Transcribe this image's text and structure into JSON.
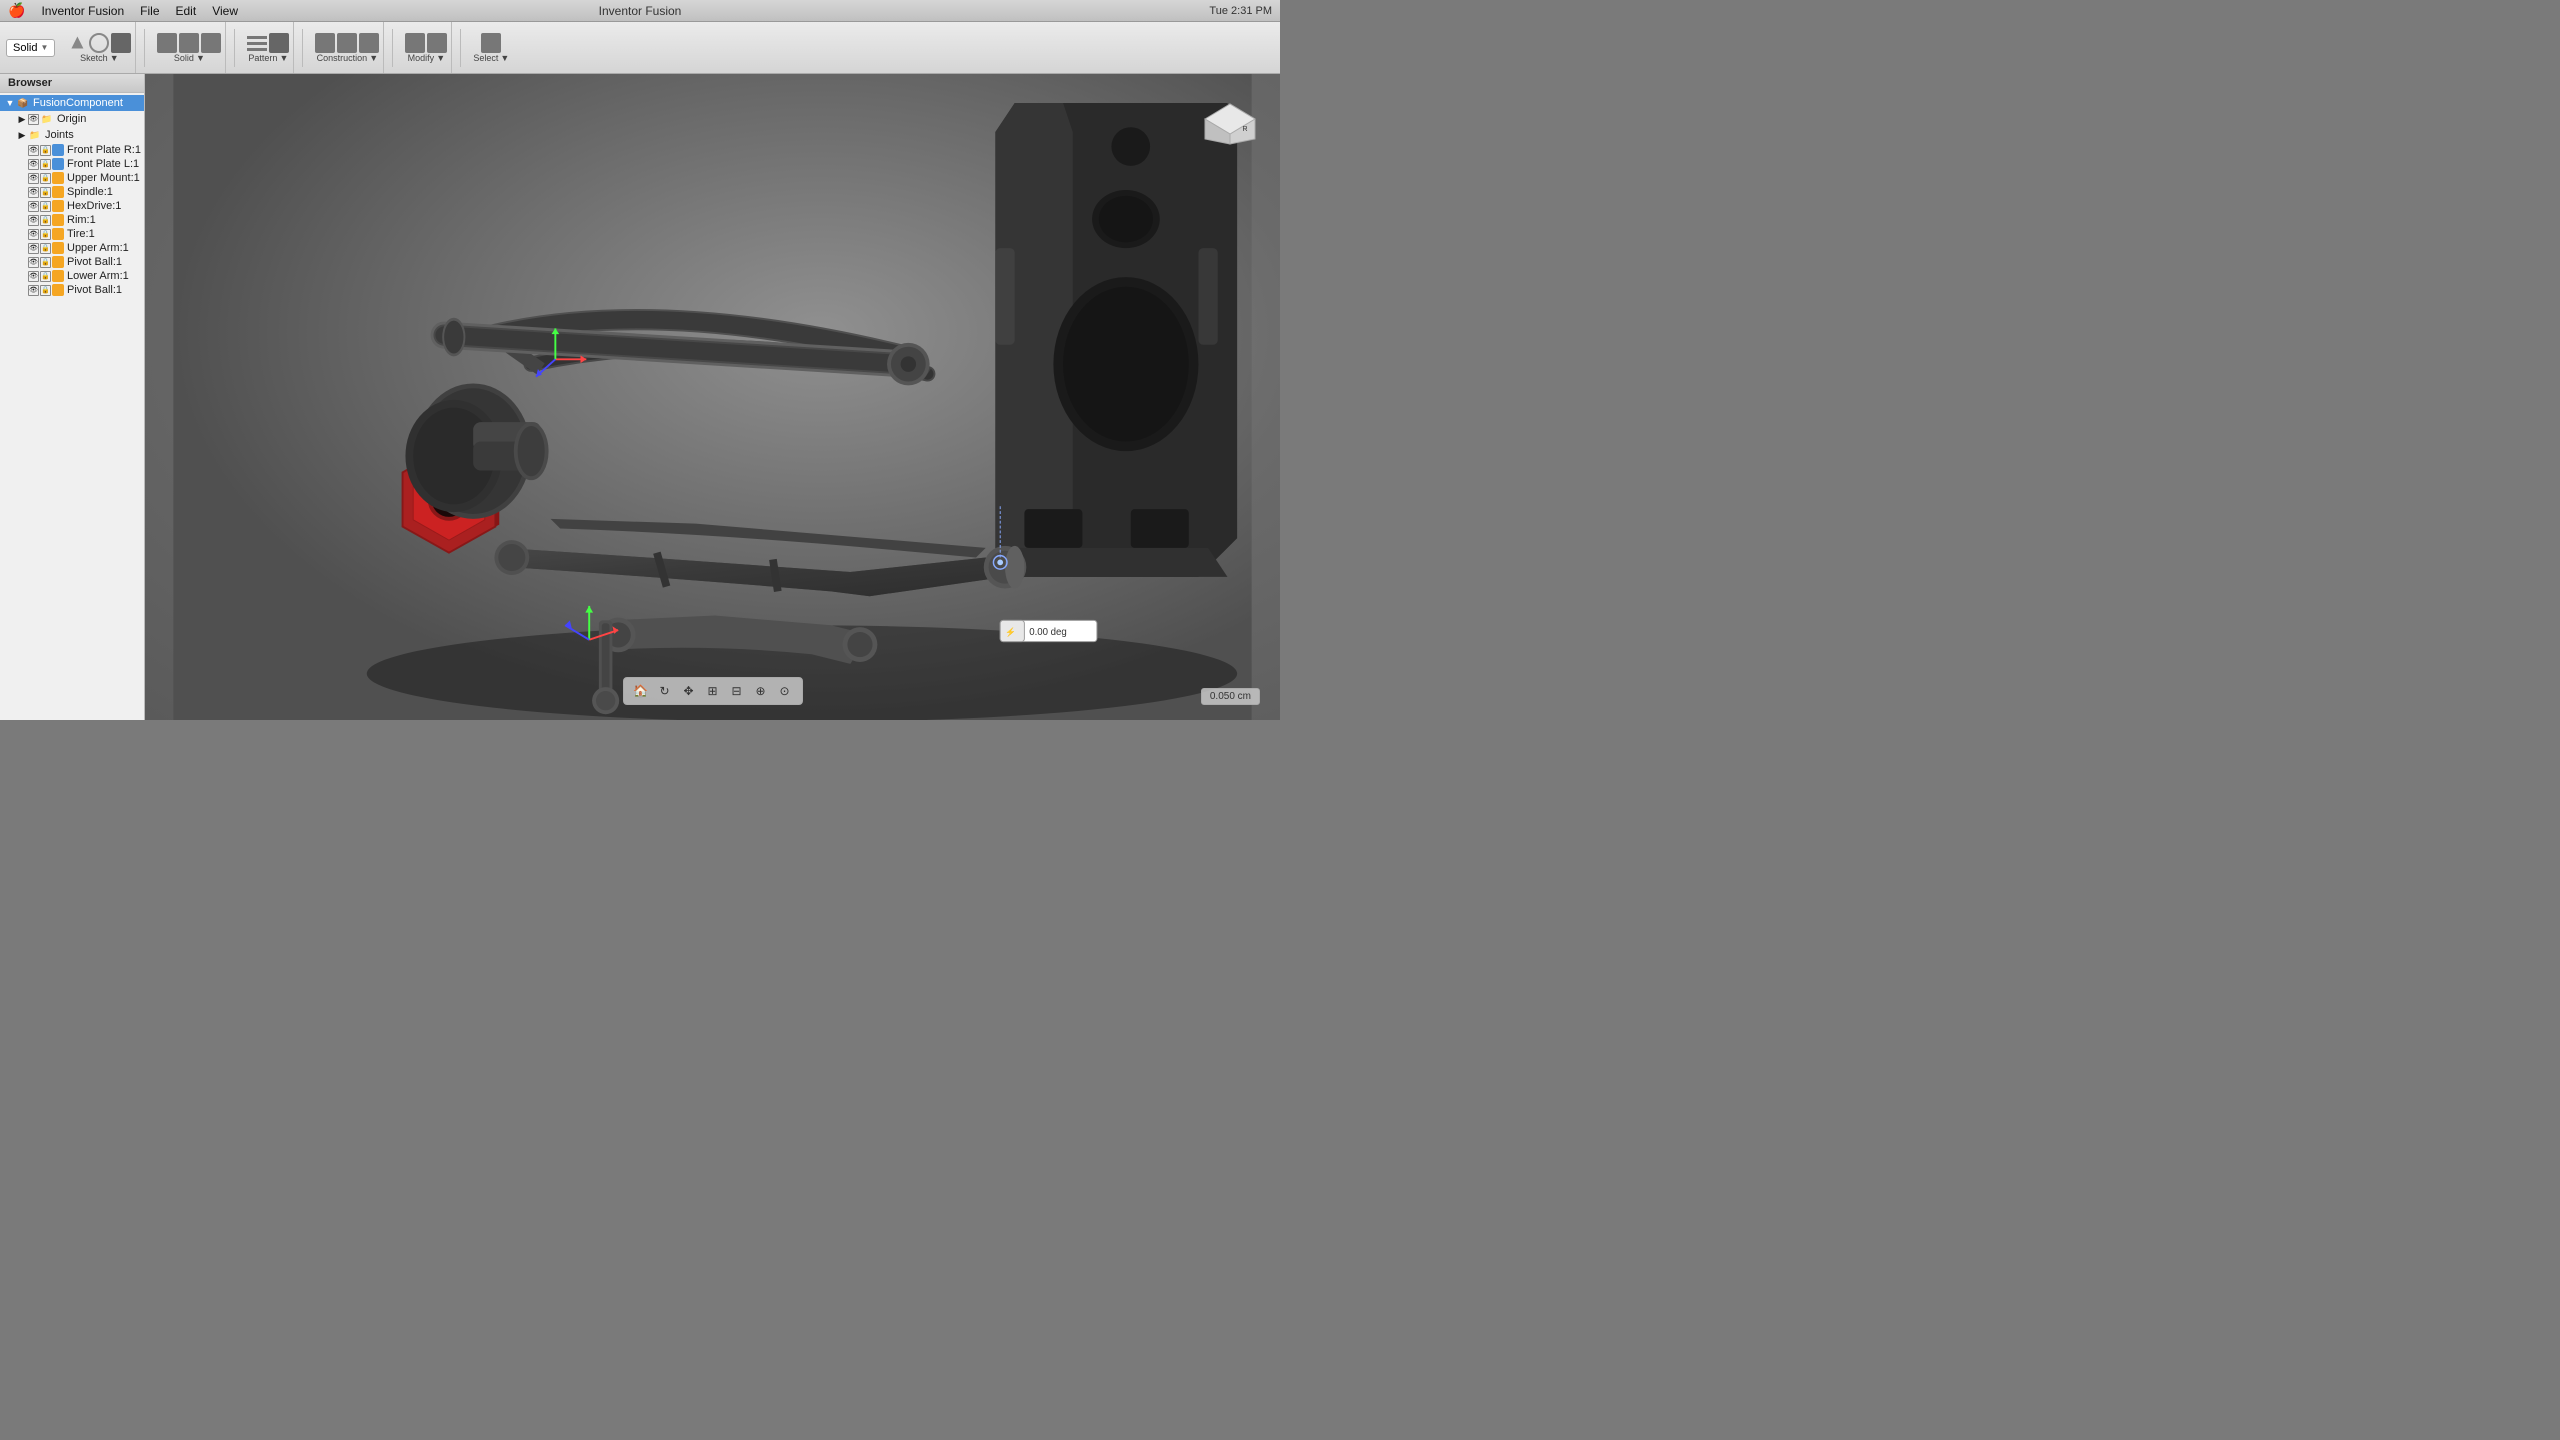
{
  "app": {
    "name": "Inventor Fusion",
    "title": "Inventor Fusion",
    "time": "Tue 2:31 PM"
  },
  "menubar": {
    "apple": "🍎",
    "items": [
      "Inventor Fusion",
      "File",
      "Edit",
      "View"
    ],
    "right_items": [
      "🔊",
      "📶",
      "🔋",
      "Tue 2:31 PM"
    ]
  },
  "toolbar": {
    "solid_label": "Solid",
    "sketch_label": "Sketch",
    "sketch_arrow": "▼",
    "solid_arrow": "▼",
    "pattern_label": "Pattern",
    "pattern_arrow": "▼",
    "construction_label": "Construction",
    "construction_arrow": "▼",
    "modify_label": "Modify",
    "modify_arrow": "▼",
    "select_label": "Select",
    "select_arrow": "▼"
  },
  "browser": {
    "title": "Browser",
    "items": [
      {
        "level": 0,
        "label": "FusionComponent",
        "type": "component",
        "expanded": true,
        "visible": true,
        "locked": false,
        "selected": true
      },
      {
        "level": 1,
        "label": "Origin",
        "type": "folder",
        "expanded": false,
        "visible": true,
        "locked": false,
        "selected": false
      },
      {
        "level": 1,
        "label": "Joints",
        "type": "folder",
        "expanded": false,
        "visible": true,
        "locked": false,
        "selected": false
      },
      {
        "level": 1,
        "label": "Front Plate R:1",
        "type": "part",
        "expanded": false,
        "visible": true,
        "locked": false,
        "selected": false
      },
      {
        "level": 1,
        "label": "Front Plate L:1",
        "type": "part",
        "expanded": false,
        "visible": true,
        "locked": false,
        "selected": false
      },
      {
        "level": 1,
        "label": "Upper Mount:1",
        "type": "part",
        "expanded": false,
        "visible": true,
        "locked": false,
        "selected": false
      },
      {
        "level": 1,
        "label": "Spindle:1",
        "type": "part",
        "expanded": false,
        "visible": true,
        "locked": false,
        "selected": false
      },
      {
        "level": 1,
        "label": "HexDrive:1",
        "type": "part",
        "expanded": false,
        "visible": true,
        "locked": false,
        "selected": false
      },
      {
        "level": 1,
        "label": "Rim:1",
        "type": "part",
        "expanded": false,
        "visible": true,
        "locked": false,
        "selected": false
      },
      {
        "level": 1,
        "label": "Tire:1",
        "type": "part",
        "expanded": false,
        "visible": true,
        "locked": false,
        "selected": false
      },
      {
        "level": 1,
        "label": "Upper Arm:1",
        "type": "part",
        "expanded": false,
        "visible": true,
        "locked": false,
        "selected": false
      },
      {
        "level": 1,
        "label": "Pivot Ball:1",
        "type": "part",
        "expanded": false,
        "visible": true,
        "locked": false,
        "selected": false
      },
      {
        "level": 1,
        "label": "Lower Arm:1",
        "type": "part",
        "expanded": false,
        "visible": true,
        "locked": false,
        "selected": false
      },
      {
        "level": 1,
        "label": "Pivot Ball:1",
        "type": "part",
        "expanded": false,
        "visible": true,
        "locked": false,
        "selected": false
      }
    ]
  },
  "viewport": {
    "dim_value": "0.00 deg",
    "scale": "0.050 cm"
  },
  "navcube": {
    "face": "Right"
  },
  "bottom_toolbar": {
    "buttons": [
      "⊕",
      "⊙",
      "↔",
      "⊞",
      "⊟",
      "⌖",
      "⊕"
    ]
  },
  "status": {
    "scale_label": "0.050 cm"
  }
}
